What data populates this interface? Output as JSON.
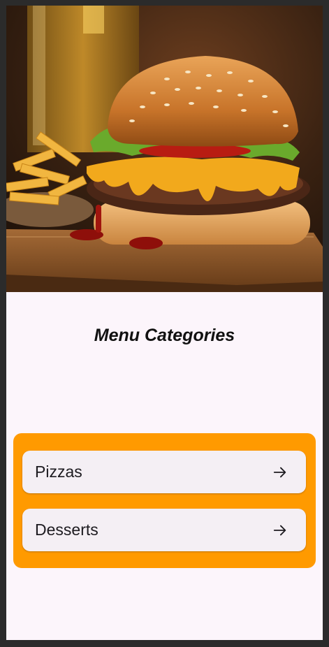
{
  "screen": {
    "title": "Menu Categories",
    "hero_image": "burger-and-fries-photo",
    "accent_color": "#ff9a00",
    "background_color": "#fcf5fb",
    "tile_color": "#f4eff4"
  },
  "categories": [
    {
      "label": "Pizzas",
      "icon": "arrow-right-icon"
    },
    {
      "label": "Desserts",
      "icon": "arrow-right-icon"
    }
  ]
}
